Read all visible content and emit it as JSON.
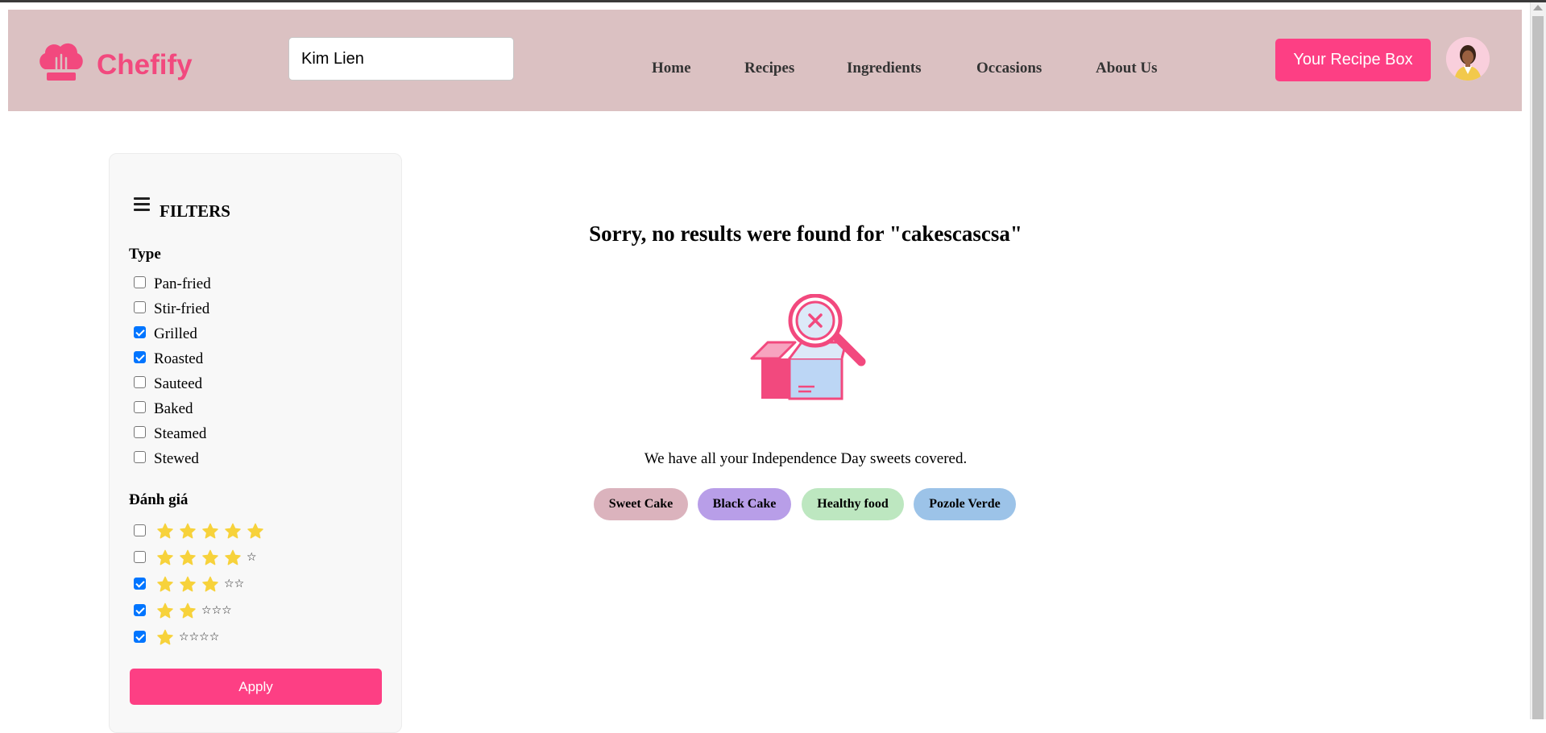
{
  "header": {
    "brand": "Chefify",
    "search_value": "Kim Lien",
    "nav": [
      "Home",
      "Recipes",
      "Ingredients",
      "Occasions",
      "About Us"
    ],
    "recipe_box_label": "Your Recipe Box",
    "brand_color": "#f2497e",
    "background_color": "#dbc1c2"
  },
  "filters": {
    "title": "FILTERS",
    "type_title": "Type",
    "types": [
      {
        "label": "Pan-fried",
        "checked": false
      },
      {
        "label": "Stir-fried",
        "checked": false
      },
      {
        "label": "Grilled",
        "checked": true
      },
      {
        "label": "Roasted",
        "checked": true
      },
      {
        "label": "Sauteed",
        "checked": false
      },
      {
        "label": "Baked",
        "checked": false
      },
      {
        "label": "Steamed",
        "checked": false
      },
      {
        "label": "Stewed",
        "checked": false
      }
    ],
    "rating_title": "Đánh giá",
    "ratings": [
      {
        "filled": 5,
        "empty": 0,
        "checked": false
      },
      {
        "filled": 4,
        "empty": 1,
        "checked": false
      },
      {
        "filled": 3,
        "empty": 2,
        "checked": true
      },
      {
        "filled": 2,
        "empty": 3,
        "checked": true
      },
      {
        "filled": 1,
        "empty": 4,
        "checked": true
      }
    ],
    "apply_label": "Apply"
  },
  "results": {
    "message": "Sorry, no results were found for \"cakescascsa\"",
    "subtext": "We have all your Independence Day sweets covered.",
    "chips": [
      {
        "label": "Sweet Cake",
        "color": "#dbb3bd"
      },
      {
        "label": "Black Cake",
        "color": "#b89ee8"
      },
      {
        "label": "Healthy food",
        "color": "#bde7c0"
      },
      {
        "label": "Pozole Verde",
        "color": "#9cc3e8"
      }
    ]
  },
  "colors": {
    "accent": "#fd3f84",
    "star": "#f7d23b",
    "checkbox": "#0075ff"
  },
  "icons": [
    "chef-hat-icon",
    "menu-icon",
    "star-icon",
    "no-results-box-icon",
    "avatar"
  ]
}
